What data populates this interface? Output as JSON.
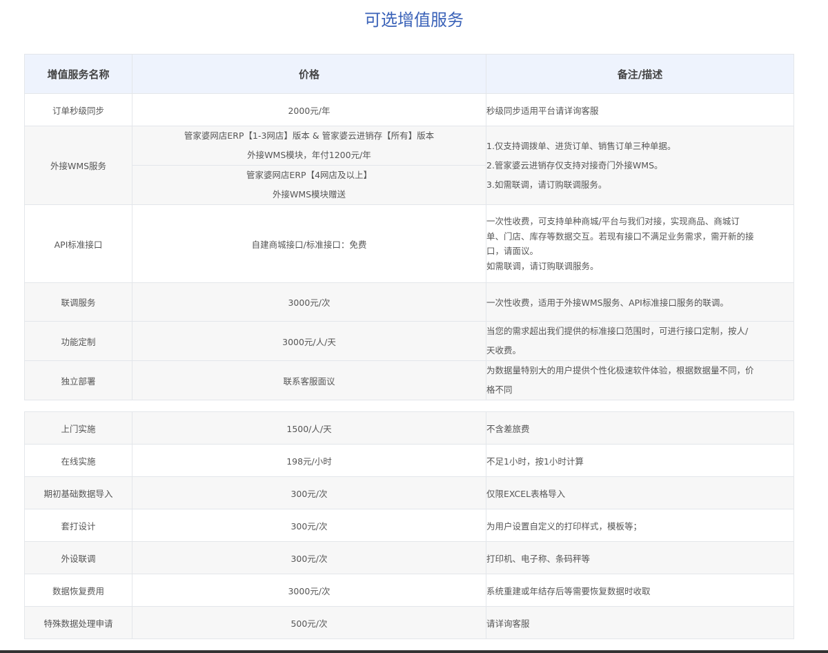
{
  "title": "可选增值服务",
  "table1": {
    "headers": {
      "name": "增值服务名称",
      "price": "价格",
      "note": "备注/描述"
    },
    "rows": [
      {
        "name": "订单秒级同步",
        "price": "2000元/年",
        "note": "秒级同步适用平台请详询客服"
      },
      {
        "name": "外接WMS服务",
        "price_a_line1": "管家婆网店ERP【1-3网店】版本 & 管家婆云进销存【所有】版本",
        "price_a_line2": "外接WMS模块，年付1200元/年",
        "price_b_line1": "管家婆网店ERP【4网店及以上】",
        "price_b_line2": "外接WMS模块赠送",
        "note_lines": [
          "1.仅支持调拨单、进货订单、销售订单三种单据。",
          "2.管家婆云进销存仅支持对接奇门外接WMS。",
          "3.如需联调，请订购联调服务。"
        ]
      },
      {
        "name": "API标准接口",
        "price": "自建商城接口/标准接口：免费",
        "note_lines": [
          "一次性收费，可支持单种商城/平台与我们对接，实现商品、商城订",
          "单、门店、库存等数据交互。若现有接口不满足业务需求，需开新的接",
          "口，请面议。",
          "如需联调，请订购联调服务。"
        ]
      },
      {
        "name": "联调服务",
        "price": "3000元/次",
        "note": "一次性收费，适用于外接WMS服务、API标准接口服务的联调。"
      },
      {
        "name": "功能定制",
        "price": "3000元/人/天",
        "note_lines": [
          "当您的需求超出我们提供的标准接口范围时，可进行接口定制，按人/",
          "天收费。"
        ]
      },
      {
        "name": "独立部署",
        "price": "联系客服面议",
        "note_lines": [
          "为数据量特别大的用户提供个性化极速软件体验，根据数据量不同，价",
          "格不同"
        ]
      }
    ]
  },
  "table2": {
    "rows": [
      {
        "name": "上门实施",
        "price": "1500/人/天",
        "note": "不含差旅费"
      },
      {
        "name": "在线实施",
        "price": "198元/小时",
        "note": "不足1小时，按1小时计算"
      },
      {
        "name": "期初基础数据导入",
        "price": "300元/次",
        "note": "仅限EXCEL表格导入"
      },
      {
        "name": "套打设计",
        "price": "300元/次",
        "note": "为用户设置自定义的打印样式，模板等；"
      },
      {
        "name": "外设联调",
        "price": "300元/次",
        "note": "打印机、电子称、条码秤等"
      },
      {
        "name": "数据恢复费用",
        "price": "3000元/次",
        "note": "系统重建或年结存后等需要恢复数据时收取"
      },
      {
        "name": "特殊数据处理申请",
        "price": "500元/次",
        "note": "请详询客服"
      }
    ]
  }
}
